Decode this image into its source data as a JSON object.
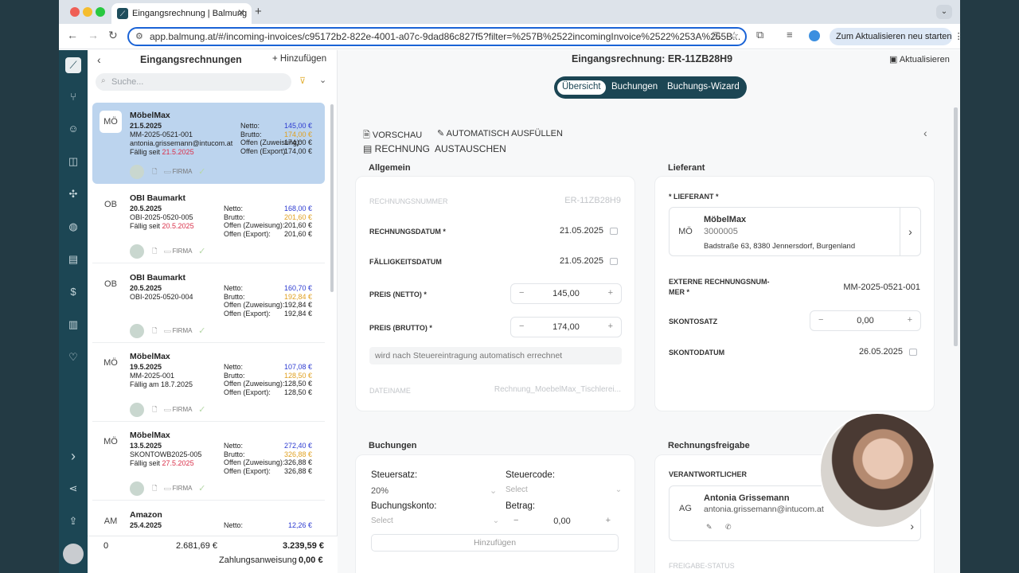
{
  "browser": {
    "tab_title": "Eingangsrechnung | Balmung",
    "url": "app.balmung.at/#/incoming-invoices/c95172b2-822e-4001-a07c-9dad86c827f5?filter=%257B%2522incomingInvoice%2522%253A%255B...",
    "update_label": "Zum Aktualisieren neu starten"
  },
  "list": {
    "title": "Eingangsrechnungen",
    "add_label": "Hinzufügen",
    "search_placeholder": "Suche...",
    "cards": [
      {
        "avatar": "MÖ",
        "name": "MöbelMax",
        "date": "21.5.2025",
        "ref": "MM-2025-0521-001",
        "extra": "antonia.grissemann@intucom.at",
        "due_prefix": "Fällig seit",
        "due": "21.5.2025",
        "netto": "145,00 €",
        "brutto": "174,00 €",
        "offen_zuweisung": "174,00 €",
        "offen_export": "174,00 €",
        "foot": "FIRMA"
      },
      {
        "avatar": "OB",
        "name": "OBI Baumarkt",
        "date": "20.5.2025",
        "ref": "OBI-2025-0520-005",
        "extra": "",
        "due_prefix": "Fällig seit",
        "due": "20.5.2025",
        "netto": "168,00 €",
        "brutto": "201,60 €",
        "offen_zuweisung": "201,60 €",
        "offen_export": "201,60 €",
        "foot": "FIRMA"
      },
      {
        "avatar": "OB",
        "name": "OBI Baumarkt",
        "date": "20.5.2025",
        "ref": "OBI-2025-0520-004",
        "extra": "",
        "due_prefix": "",
        "due": "",
        "netto": "160,70 €",
        "brutto": "192,84 €",
        "offen_zuweisung": "192,84 €",
        "offen_export": "192,84 €",
        "foot": "FIRMA"
      },
      {
        "avatar": "MÖ",
        "name": "MöbelMax",
        "date": "19.5.2025",
        "ref": "MM-2025-001",
        "extra": "",
        "due_prefix": "Fällig am 18.7.2025",
        "due": "",
        "netto": "107,08 €",
        "brutto": "128,50 €",
        "offen_zuweisung": "128,50 €",
        "offen_export": "128,50 €",
        "foot": "FIRMA"
      },
      {
        "avatar": "MÖ",
        "name": "MöbelMax",
        "date": "13.5.2025",
        "ref": "SKONTOWB2025-005",
        "extra": "",
        "due_prefix": "Fällig seit",
        "due": "27.5.2025",
        "netto": "272,40 €",
        "brutto": "326,88 €",
        "offen_zuweisung": "326,88 €",
        "offen_export": "326,88 €",
        "foot": "FIRMA"
      },
      {
        "avatar": "AM",
        "name": "Amazon",
        "date": "25.4.2025",
        "ref": "",
        "extra": "",
        "due_prefix": "",
        "due": "",
        "netto": "12,26 €",
        "brutto": "",
        "offen_zuweisung": "",
        "offen_export": "",
        "foot": ""
      }
    ],
    "labels": {
      "netto": "Netto:",
      "brutto": "Brutto:",
      "oz": "Offen (Zuweisung):",
      "oe": "Offen (Export):"
    },
    "totals": {
      "count": "0",
      "netto": "2.681,69 €",
      "brutto": "3.239,59 €",
      "zahlung_label": "Zahlungsanweisung",
      "zahlung": "0,00 €"
    }
  },
  "main": {
    "title": "Eingangsrechnung: ER-11ZB28H9",
    "refresh": "Aktualisieren",
    "tabs": [
      "Übersicht",
      "Buchungen",
      "Buchungs-Wizard"
    ],
    "vorschau": "VORSCHAU",
    "auto": "AUTOMATISCH AUSFÜLLEN",
    "tausch": "RECHNUNG  AUSTAUSCHEN",
    "allgemein": {
      "title": "Allgemein",
      "rn_label": "RECHNUNGSNUMMER",
      "rn": "ER-11ZB28H9",
      "rd_label": "RECHNUNGSDATUM *",
      "rd": "21.05.2025",
      "fd_label": "FÄLLIGKEITSDATUM",
      "fd": "21.05.2025",
      "pn_label": "PREIS (NETTO) *",
      "pn": "145,00",
      "pb_label": "PREIS (BRUTTO) *",
      "pb": "174,00",
      "hint": "wird nach Steuereintragung automatisch errechnet",
      "dn_label": "DATEINAME",
      "dn": "Rechnung_MoebelMax_Tischlerei..."
    },
    "lieferant": {
      "title": "Lieferant",
      "label": "* LIEFERANT *",
      "avatar": "MÖ",
      "name": "MöbelMax",
      "nr": "3000005",
      "addr": "Badstraße 63, 8380 Jennersdorf, Burgenland",
      "ext_label1": "EXTERNE RECHNUNGSNUM-",
      "ext_label2": "MER *",
      "ext": "MM-2025-0521-001",
      "skonto_label": "SKONTOSATZ",
      "skonto": "0,00",
      "sd_label": "SKONTODATUM",
      "sd": "26.05.2025"
    },
    "buchungen": {
      "title": "Buchungen",
      "st_label": "Steuersatz:",
      "st": "20%",
      "sc_label": "Steuercode:",
      "sc": "Select",
      "bk_label": "Buchungskonto:",
      "bk": "Select",
      "betrag_label": "Betrag:",
      "betrag": "0,00",
      "add": "Hinzufügen"
    },
    "freigabe": {
      "title": "Rechnungsfreigabe",
      "label": "VERANTWORTLICHER",
      "avatar": "AG",
      "name": "Antonia Grissemann",
      "email": "antonia.grissemann@intucom.at",
      "status": "FREIGABE-STATUS"
    }
  }
}
